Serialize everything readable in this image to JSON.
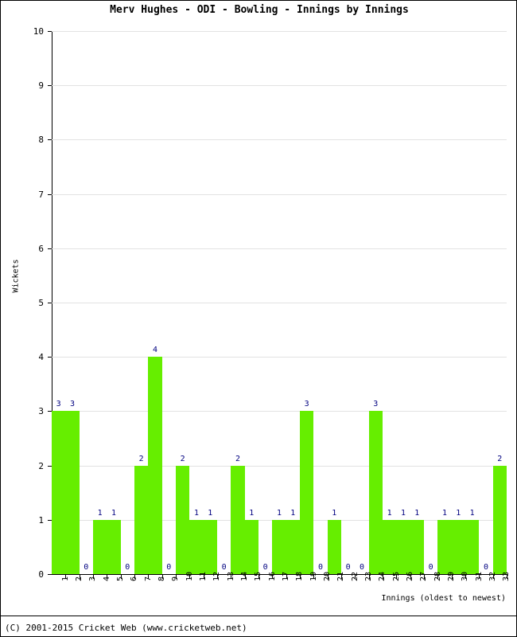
{
  "chart_data": {
    "type": "bar",
    "title": "Merv Hughes - ODI - Bowling - Innings by Innings",
    "xlabel": "Innings (oldest to newest)",
    "ylabel": "Wickets",
    "ylim": [
      0,
      10
    ],
    "ytick_labels": [
      "0",
      "1",
      "2",
      "3",
      "4",
      "5",
      "6",
      "7",
      "8",
      "9",
      "10"
    ],
    "grid": true,
    "legend": null,
    "bar_color": "#66ee00",
    "label_color": "#000080",
    "categories": [
      "1",
      "2",
      "3",
      "4",
      "5",
      "6",
      "7",
      "8",
      "9",
      "10",
      "11",
      "12",
      "13",
      "14",
      "15",
      "16",
      "17",
      "18",
      "19",
      "20",
      "21",
      "22",
      "23",
      "24",
      "25",
      "26",
      "27",
      "28",
      "29",
      "30",
      "31",
      "32",
      "33"
    ],
    "values": [
      3,
      3,
      0,
      1,
      1,
      0,
      2,
      4,
      0,
      2,
      1,
      1,
      0,
      2,
      1,
      0,
      1,
      1,
      3,
      0,
      1,
      0,
      0,
      3,
      1,
      1,
      1,
      0,
      1,
      1,
      1,
      0,
      2
    ],
    "value_labels": [
      "3",
      "3",
      "0",
      "1",
      "1",
      "0",
      "2",
      "4",
      "0",
      "2",
      "1",
      "1",
      "0",
      "2",
      "1",
      "0",
      "1",
      "1",
      "3",
      "0",
      "1",
      "0",
      "0",
      "3",
      "1",
      "1",
      "1",
      "0",
      "1",
      "1",
      "1",
      "0",
      "2"
    ]
  },
  "footer": {
    "copyright": "(C) 2001-2015 Cricket Web (www.cricketweb.net)"
  }
}
